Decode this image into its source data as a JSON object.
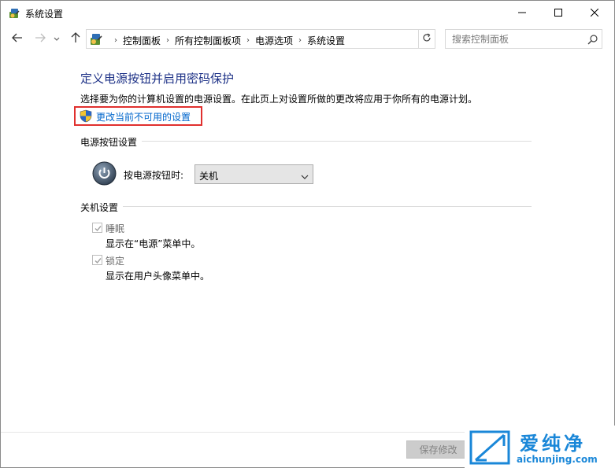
{
  "window": {
    "title": "系统设置",
    "minimize_icon": "minimize-icon",
    "maximize_icon": "maximize-icon",
    "close_icon": "close-icon"
  },
  "nav": {
    "breadcrumbs": [
      "控制面板",
      "所有控制面板项",
      "电源选项",
      "系统设置"
    ],
    "search_placeholder": "搜索控制面板"
  },
  "content": {
    "heading": "定义电源按钮并启用密码保护",
    "description": "选择要为你的计算机设置的电源设置。在此页上对设置所做的更改将应用于你所有的电源计划。",
    "change_link": "更改当前不可用的设置",
    "power_section": {
      "title": "电源按钮设置",
      "label": "按电源按钮时:",
      "selected": "关机"
    },
    "shutdown_section": {
      "title": "关机设置",
      "options": [
        {
          "label": "睡眠",
          "desc": "显示在“电源”菜单中。",
          "checked": true
        },
        {
          "label": "锁定",
          "desc": "显示在用户头像菜单中。",
          "checked": true
        }
      ]
    },
    "save_button": "保存修改"
  },
  "watermark": {
    "brand": "爱纯净",
    "url": "aichunjing.com"
  },
  "colors": {
    "heading": "#1e3287",
    "link": "#0066cc",
    "highlight_box": "#e0302e",
    "watermark": "#1a87d8"
  }
}
